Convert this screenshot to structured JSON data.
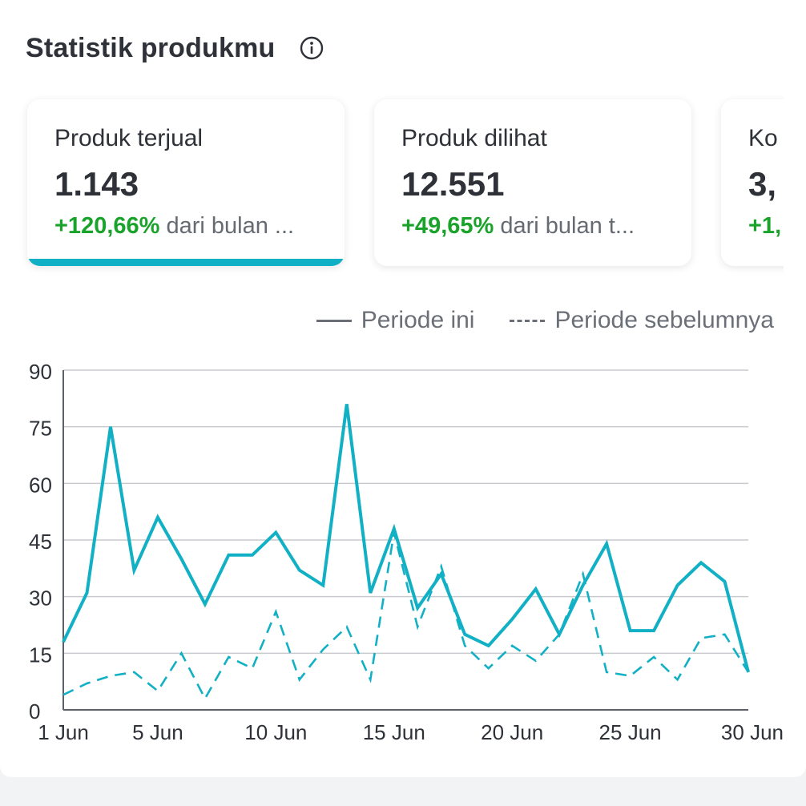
{
  "header": {
    "title": "Statistik produkmu",
    "info_icon": "info-icon"
  },
  "cards": [
    {
      "label": "Produk terjual",
      "value": "1.143",
      "change": "+120,66%",
      "suffix": " dari bulan ...",
      "active": true
    },
    {
      "label": "Produk dilihat",
      "value": "12.551",
      "change": "+49,65%",
      "suffix": " dari bulan t...",
      "active": false
    },
    {
      "label": "Ko",
      "value": "3,",
      "change": "+1,",
      "suffix": "",
      "active": false
    }
  ],
  "legend": {
    "current": "Periode ini",
    "previous": "Periode sebelumnya"
  },
  "colors": {
    "series": "#12b0c4",
    "positive": "#1aa32b",
    "grid": "#c8cacd",
    "text": "#2e3137"
  },
  "chart_data": {
    "type": "line",
    "x": [
      1,
      2,
      3,
      4,
      5,
      6,
      7,
      8,
      9,
      10,
      11,
      12,
      13,
      14,
      15,
      16,
      17,
      18,
      19,
      20,
      21,
      22,
      23,
      24,
      25,
      26,
      27,
      28,
      29,
      30
    ],
    "x_tick_values": [
      1,
      5,
      10,
      15,
      20,
      25,
      30
    ],
    "x_tick_labels": [
      "1 Jun",
      "5 Jun",
      "10 Jun",
      "15 Jun",
      "20 Jun",
      "25 Jun",
      "30 Jun"
    ],
    "y_ticks": [
      0,
      15,
      30,
      45,
      60,
      75,
      90
    ],
    "ylim": [
      0,
      90
    ],
    "grid": true,
    "legend_position": "top-right",
    "series": [
      {
        "name": "Periode ini",
        "style": "solid",
        "values": [
          18,
          31,
          75,
          37,
          51,
          40,
          28,
          41,
          41,
          47,
          37,
          33,
          81,
          31,
          48,
          27,
          36,
          20,
          17,
          24,
          32,
          20,
          33,
          44,
          21,
          21,
          33,
          39,
          34,
          10
        ]
      },
      {
        "name": "Periode sebelumnya",
        "style": "dashed",
        "values": [
          4,
          7,
          9,
          10,
          5,
          15,
          3,
          14,
          11,
          26,
          8,
          16,
          22,
          8,
          47,
          22,
          38,
          17,
          11,
          17,
          13,
          20,
          36,
          10,
          9,
          14,
          8,
          19,
          20,
          10
        ]
      }
    ]
  }
}
